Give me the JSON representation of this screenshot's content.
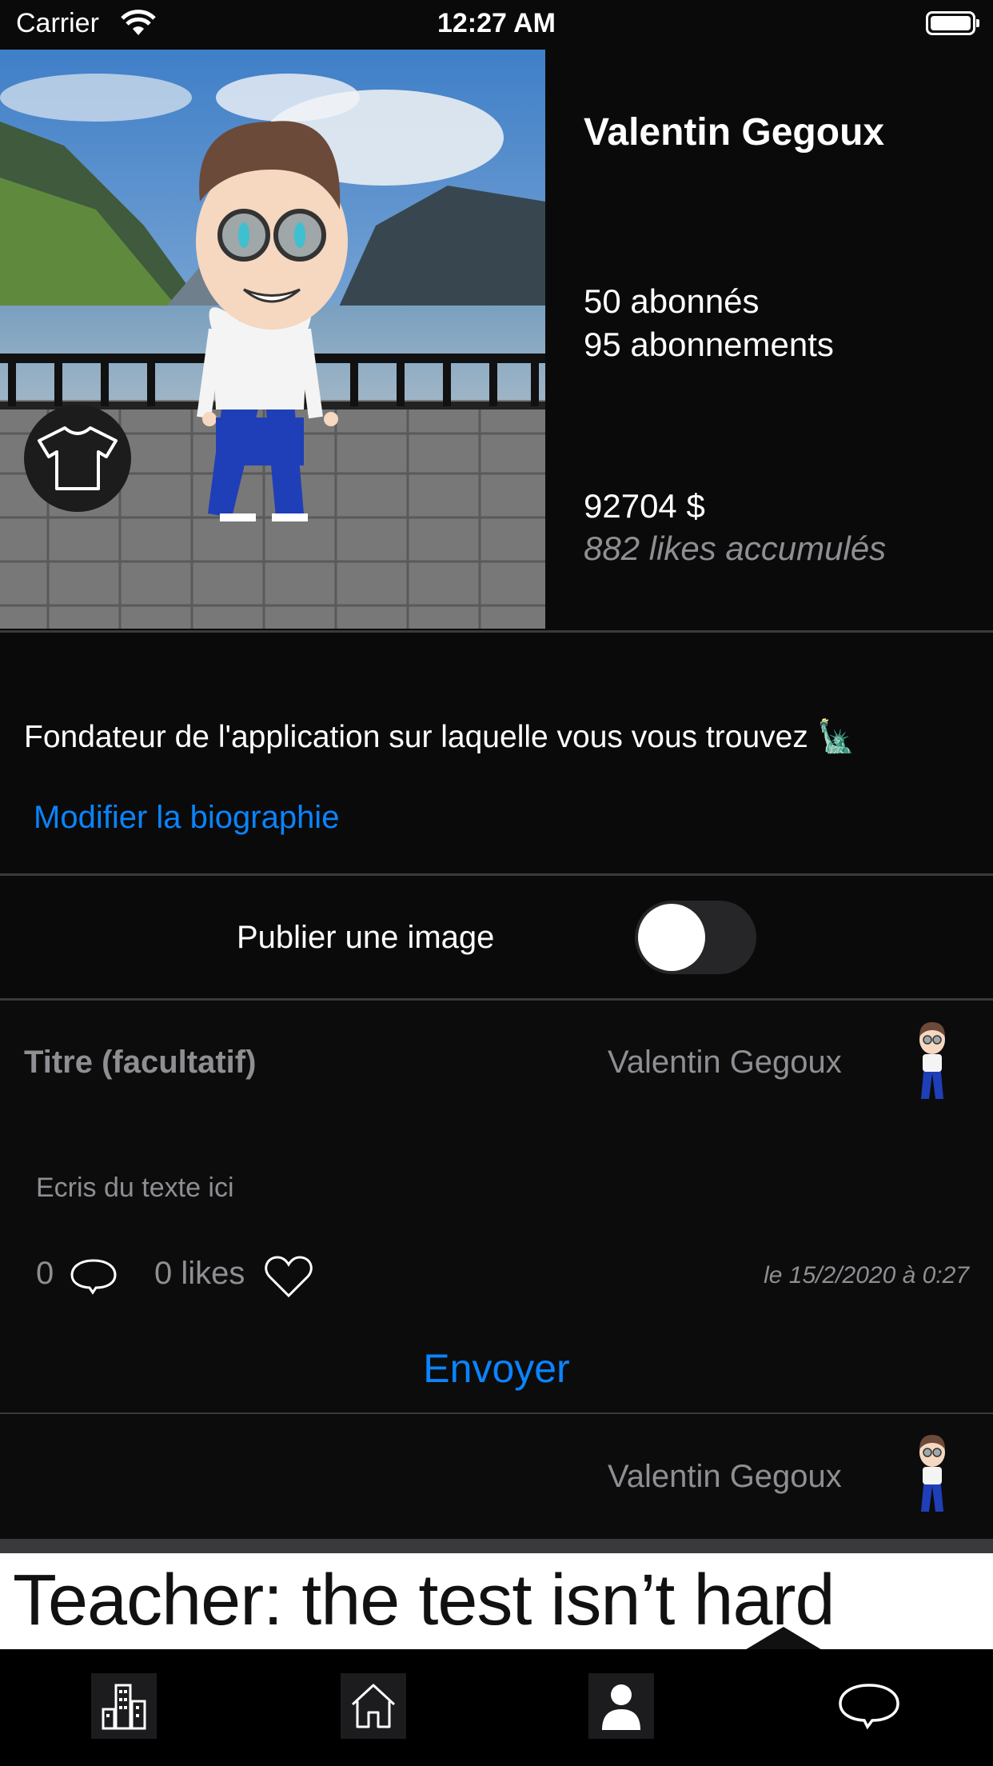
{
  "status_bar": {
    "carrier": "Carrier",
    "time": "12:27 AM",
    "battery_level": 1.0
  },
  "profile": {
    "name": "Valentin Gegoux",
    "followers": "50 abonnés",
    "following": "95 abonnements",
    "money": "92704 $",
    "likes_accumulated": "882 likes accumulés",
    "bio": "Fondateur de l'application sur laquelle vous vous trouvez 🗽",
    "edit_bio_label": "Modifier la biographie",
    "shirt_button_icon": "tshirt-icon"
  },
  "publish": {
    "label": "Publier une image",
    "toggle_on": false
  },
  "new_post": {
    "title_placeholder": "Titre (facultatif)",
    "author": "Valentin Gegoux",
    "text_placeholder": "Ecris du texte ici",
    "comment_count": "0",
    "likes": "0 likes",
    "date": "le 15/2/2020 à 0:27",
    "send_label": "Envoyer"
  },
  "feed_post": {
    "author": "Valentin Gegoux",
    "image_text": "Teacher:  the test isn’t hard"
  },
  "tab_bar": {
    "items": [
      "city-icon",
      "home-icon",
      "profile-icon",
      "chat-icon"
    ],
    "active_index": 2
  },
  "colors": {
    "accent": "#0a84ff",
    "background": "#0a0a0a",
    "secondary_text": "#8e8e93"
  }
}
